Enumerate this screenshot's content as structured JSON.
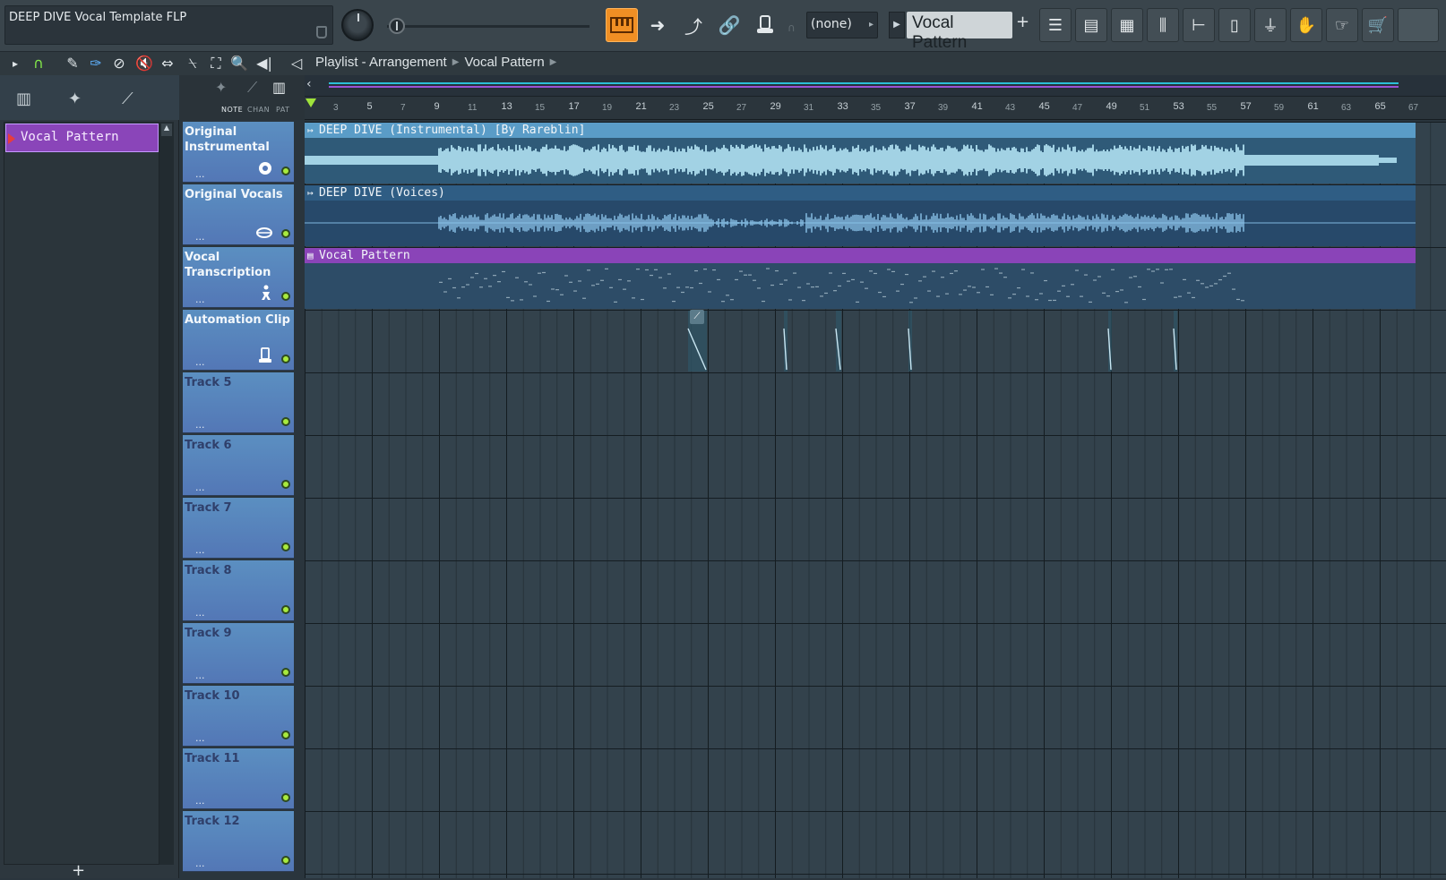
{
  "window": {
    "hint_title": "DEEP DIVE Vocal Template FLP"
  },
  "toolbar": {
    "snap_value": "(none)",
    "pattern_name": "Vocal Pattern",
    "pattern_add": "+"
  },
  "breadcrumb": {
    "part1": "Playlist - Arrangement",
    "part2": "Vocal Pattern"
  },
  "picker": {
    "items": [
      {
        "label": "Vocal Pattern"
      }
    ],
    "add_label": "+"
  },
  "header_labels": {
    "note": "NOTE",
    "chan": "CHAN",
    "pat": "PAT"
  },
  "ruler": {
    "bars": [
      "3",
      "5",
      "7",
      "9",
      "11",
      "13",
      "15",
      "17",
      "19",
      "21",
      "23",
      "25",
      "27",
      "29",
      "31",
      "33",
      "35",
      "37",
      "39",
      "41",
      "43",
      "45",
      "47",
      "49",
      "51",
      "53",
      "55",
      "57",
      "59",
      "61",
      "63",
      "65",
      "67"
    ]
  },
  "tracks": [
    {
      "name": "Original Instrumental",
      "icon": "disc-icon"
    },
    {
      "name": "Original Vocals",
      "icon": "lips-icon"
    },
    {
      "name": "Vocal Transcription",
      "icon": "person-icon"
    },
    {
      "name": "Automation Clip",
      "icon": "hat-icon"
    },
    {
      "name": "Track 5"
    },
    {
      "name": "Track 6"
    },
    {
      "name": "Track 7"
    },
    {
      "name": "Track 8"
    },
    {
      "name": "Track 9"
    },
    {
      "name": "Track 10"
    },
    {
      "name": "Track 11"
    },
    {
      "name": "Track 12"
    }
  ],
  "clips": {
    "instrumental": "DEEP DIVE (Instrumental) [By Rareblin]",
    "vocals": "DEEP DIVE  (Voices)",
    "pattern": "Vocal Pattern"
  },
  "colors": {
    "accent": "#f08f24",
    "pattern": "#8a44b8",
    "track_header": "#5377b6",
    "led": "#a8ea3e"
  }
}
